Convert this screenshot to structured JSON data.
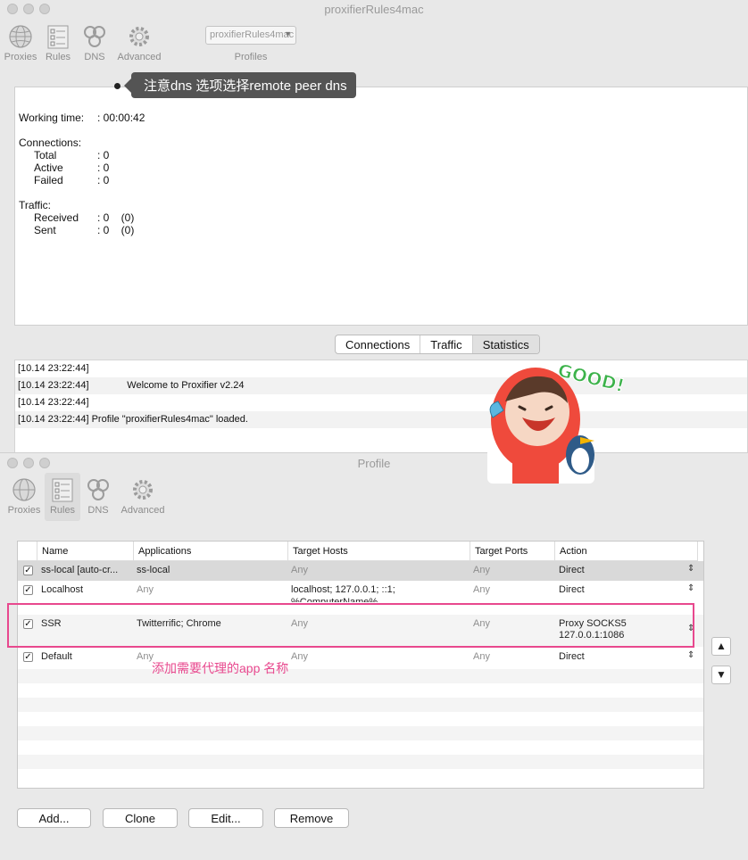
{
  "main_window": {
    "title": "proxifierRules4mac",
    "toolbar": [
      {
        "label": "Proxies",
        "icon": "globe-icon"
      },
      {
        "label": "Rules",
        "icon": "rules-icon"
      },
      {
        "label": "DNS",
        "icon": "dns-icon"
      },
      {
        "label": "Advanced",
        "icon": "gear-icon"
      }
    ],
    "profile_select": "proxifierRules4mac",
    "profiles_label": "Profiles",
    "annotation": "注意dns 选项选择remote peer dns",
    "stats": {
      "working_time_label": "Working time:",
      "working_time_value": ": 00:00:42",
      "connections_label": "Connections:",
      "total_label": "Total",
      "total_value": ": 0",
      "active_label": "Active",
      "active_value": ": 0",
      "failed_label": "Failed",
      "failed_value": ": 0",
      "traffic_label": "Traffic:",
      "received_label": "Received",
      "received_value": ": 0    (0)",
      "sent_label": "Sent",
      "sent_value": ": 0    (0)"
    },
    "tabs": [
      "Connections",
      "Traffic",
      "Statistics"
    ],
    "selected_tab": "Statistics",
    "log": [
      "[10.14 23:22:44]",
      "[10.14 23:22:44]              Welcome to Proxifier v2.24",
      "[10.14 23:22:44]",
      "[10.14 23:22:44] Profile \"proxifierRules4mac\" loaded."
    ],
    "sticker_text": "GOOD!"
  },
  "profile_window": {
    "title": "Profile",
    "toolbar": [
      {
        "label": "Proxies",
        "icon": "globe-icon"
      },
      {
        "label": "Rules",
        "icon": "rules-icon"
      },
      {
        "label": "DNS",
        "icon": "dns-icon"
      },
      {
        "label": "Advanced",
        "icon": "gear-icon"
      }
    ],
    "selected_toolbar": "Rules",
    "columns": [
      "Name",
      "Applications",
      "Target Hosts",
      "Target Ports",
      "Action"
    ],
    "rules": [
      {
        "checked": true,
        "name": "ss-local [auto-cr...",
        "applications": "ss-local",
        "hosts": "Any",
        "ports": "Any",
        "action": "Direct",
        "selected": true
      },
      {
        "checked": true,
        "name": "Localhost",
        "applications": "Any",
        "hosts": "localhost; 127.0.0.1; ::1;",
        "hosts2": "%ComputerName%",
        "ports": "Any",
        "action": "Direct"
      },
      {
        "checked": true,
        "name": "SSR",
        "applications": "Twitterrific; Chrome",
        "hosts": "Any",
        "ports": "Any",
        "action": "Proxy SOCKS5",
        "action2": "127.0.0.1:1086"
      },
      {
        "checked": true,
        "name": "Default",
        "applications": "Any",
        "hosts": "Any",
        "ports": "Any",
        "action": "Direct"
      }
    ],
    "hint": "添加需要代理的app 名称",
    "buttons": {
      "add": "Add...",
      "clone": "Clone",
      "edit": "Edit...",
      "remove": "Remove"
    },
    "move_up": "▲",
    "move_down": "▼"
  },
  "colors": {
    "highlight": "#e8488e",
    "tooltip": "#545454"
  }
}
